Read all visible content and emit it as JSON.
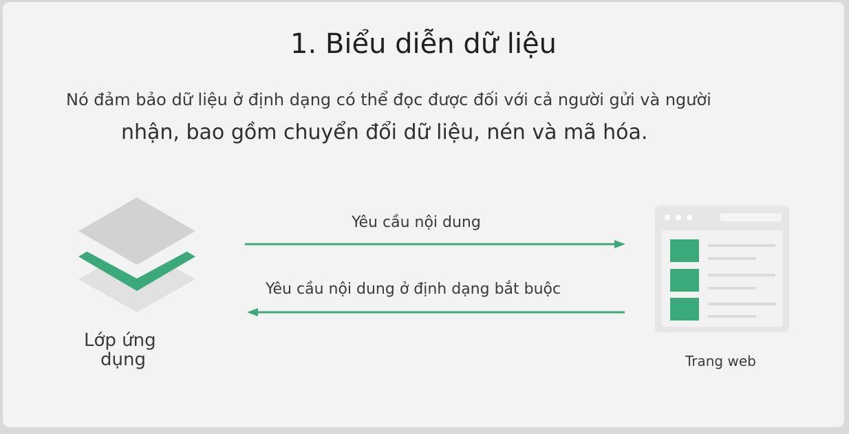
{
  "title": "1. Biểu diễn dữ liệu",
  "description": {
    "line1": "Nó đảm bảo dữ liệu ở định dạng có thể đọc được đối với cả người gửi và người",
    "line2": "nhận, bao gồm chuyển đổi dữ liệu, nén và mã hóa."
  },
  "arrows": {
    "top_label": "Yêu cầu nội dung",
    "bottom_label": "Yêu cầu nội dung ở định dạng bắt buộc"
  },
  "nodes": {
    "layer_label_line1": "Lớp ứng",
    "layer_label_line2": "dụng",
    "web_label": "Trang web"
  },
  "colors": {
    "accent": "#3aaa7a",
    "layer_gray": "#d2d2d2",
    "panel_gray": "#e6e6e6"
  }
}
